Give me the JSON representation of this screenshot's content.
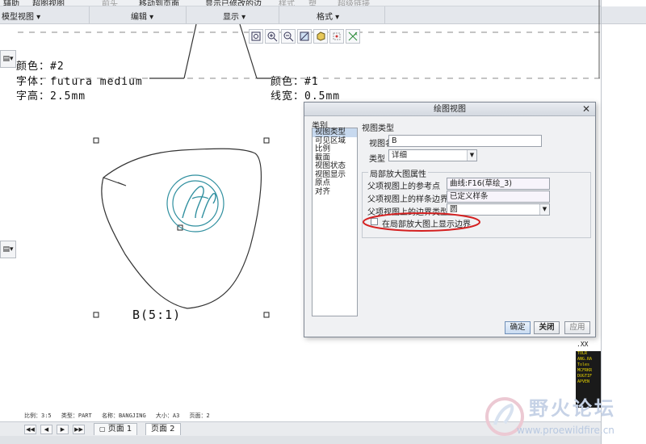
{
  "ribbon": {
    "top_buttons": [
      "辅助",
      "超图视图",
      "前头",
      "移动到页面",
      "显示已修改的边",
      "样式",
      "塑",
      "超级链接"
    ],
    "groups": [
      "模型视图",
      "编辑",
      "显示",
      "格式"
    ]
  },
  "graphics_toolbar": [
    "zoom-fit-icon",
    "zoom-in-icon",
    "zoom-out-icon",
    "repaint-icon",
    "shading-icon",
    "datum-icon",
    "axis-icon"
  ],
  "drawing": {
    "left_note": [
      "颜色：#2",
      "字体：futura medium",
      "字高：2.5mm"
    ],
    "right_note": [
      "颜色：#1",
      "线宽：0.5mm"
    ],
    "view_label": "B(5:1)"
  },
  "dialog": {
    "title": "绘图视图",
    "category_label": "类别",
    "categories": [
      "视图类型",
      "可见区域",
      "比例",
      "截面",
      "视图状态",
      "视图显示",
      "原点",
      "对齐"
    ],
    "selected_category": "视图类型",
    "section_view_type": "视图类型",
    "view_name_label": "视图名",
    "view_name_value": "B",
    "type_label": "类型",
    "type_value": "详细",
    "detail_section": "局部放大图属性",
    "ref_point_label": "父项视图上的参考点",
    "ref_point_value": "曲线:F16(草绘_3)",
    "spline_label": "父项视图上的样条边界",
    "spline_value": "已定义样条",
    "boundary_type_label": "父项视图上的边界类型",
    "boundary_type_value": "圆",
    "show_boundary_label": "在局部放大图上显示边界",
    "show_boundary_checked": false,
    "buttons": {
      "ok": "确定",
      "close": "关闭",
      "apply": "应用"
    }
  },
  "status_bar": {
    "scale": "比例：3:5",
    "type": "类型：PART",
    "name": "名称：BANGJING",
    "size": "大小：A3",
    "sheet": "页面：2"
  },
  "page_tabs": [
    "页面 1",
    "页面 2"
  ],
  "watermark": {
    "title": "野火论坛",
    "url": "www.proewildfire.cn"
  },
  "right_panel": {
    "top_label": ".XX",
    "yellow_lines": [
      "TOLR",
      "ANG.RA",
      "Toles",
      "MCFRKR",
      "DUGTIF",
      "APVEN"
    ]
  },
  "colors": {
    "highlight_oval": "#d42020",
    "detail_circle": "#2f8f9f",
    "dialog_bg": "#f0f1f3",
    "selected_row": "#c7d9ef"
  }
}
